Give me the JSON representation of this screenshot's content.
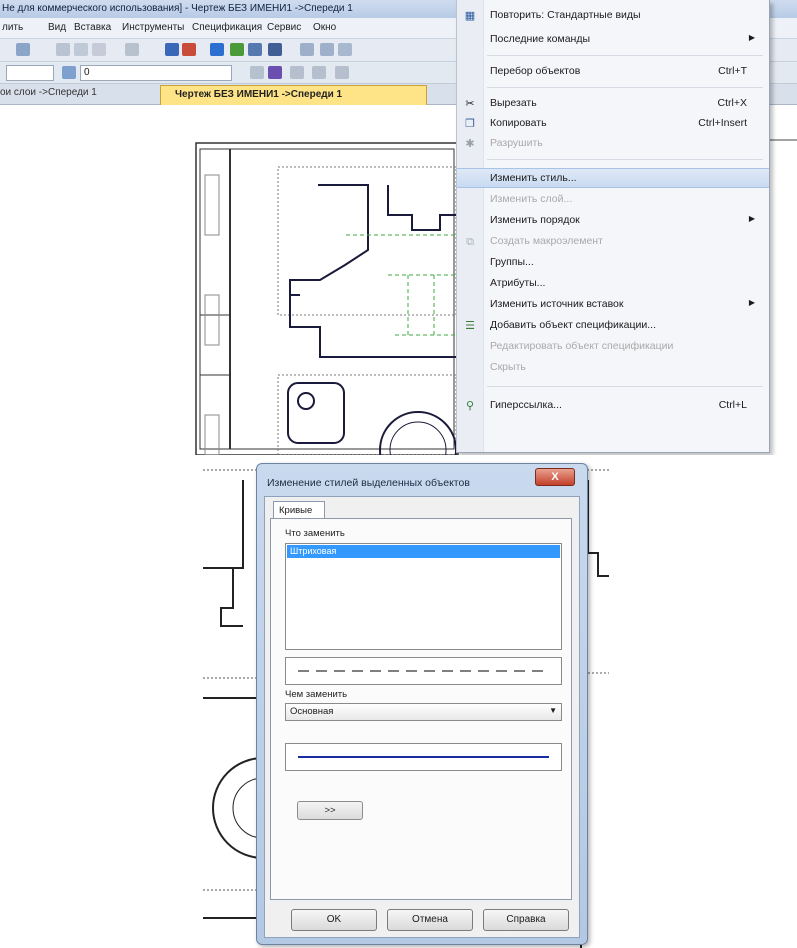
{
  "app": {
    "title": "Не для коммерческого использования] - Чертеж БЕЗ ИМЕНИ1 ->Спереди 1",
    "menu": [
      "лить",
      "Вид",
      "Вставка",
      "Инструменты",
      "Спецификация",
      "Сервис",
      "Окно"
    ],
    "toolbar": {
      "layer_value": "0"
    },
    "tabs": [
      "ои слои ->Спереди 1",
      "Чертеж БЕЗ ИМЕНИ1 ->Спереди 1"
    ]
  },
  "context_menu": {
    "items": [
      {
        "label": "Повторить: Стандартные виды",
        "shortcut": "",
        "icon": "views-icon"
      },
      {
        "label": "Последние команды",
        "shortcut": "",
        "submenu": true
      },
      {
        "label": "Перебор объектов",
        "shortcut": "Ctrl+T"
      },
      {
        "label": "Вырезать",
        "shortcut": "Ctrl+X",
        "icon": "scissors-icon"
      },
      {
        "label": "Копировать",
        "shortcut": "Ctrl+Insert",
        "icon": "copy-icon"
      },
      {
        "label": "Разрушить",
        "shortcut": "",
        "disabled": true
      },
      {
        "label": "Изменить стиль...",
        "shortcut": "",
        "highlighted": true
      },
      {
        "label": "Изменить слой...",
        "shortcut": "",
        "disabled": true
      },
      {
        "label": "Изменить порядок",
        "shortcut": "",
        "submenu": true
      },
      {
        "label": "Создать макроэлемент",
        "shortcut": "",
        "disabled": true
      },
      {
        "label": "Группы...",
        "shortcut": ""
      },
      {
        "label": "Атрибуты...",
        "shortcut": ""
      },
      {
        "label": "Изменить источник вставок",
        "shortcut": "",
        "submenu": true
      },
      {
        "label": "Добавить объект спецификации...",
        "shortcut": "",
        "icon": "spec-icon"
      },
      {
        "label": "Редактировать объект спецификации",
        "shortcut": "",
        "disabled": true
      },
      {
        "label": "Скрыть",
        "shortcut": "",
        "disabled": true
      },
      {
        "label": "Гиперссылка...",
        "shortcut": "Ctrl+L",
        "icon": "hyperlink-icon"
      }
    ]
  },
  "dialog": {
    "title": "Изменение стилей выделенных объектов",
    "close_label": "X",
    "tab": "Кривые",
    "what_label": "Что заменить",
    "what_selected": "Штриховая",
    "with_label": "Чем заменить",
    "with_value": "Основная",
    "more_button": ">>",
    "ok": "OK",
    "cancel": "Отмена",
    "help": "Справка"
  }
}
